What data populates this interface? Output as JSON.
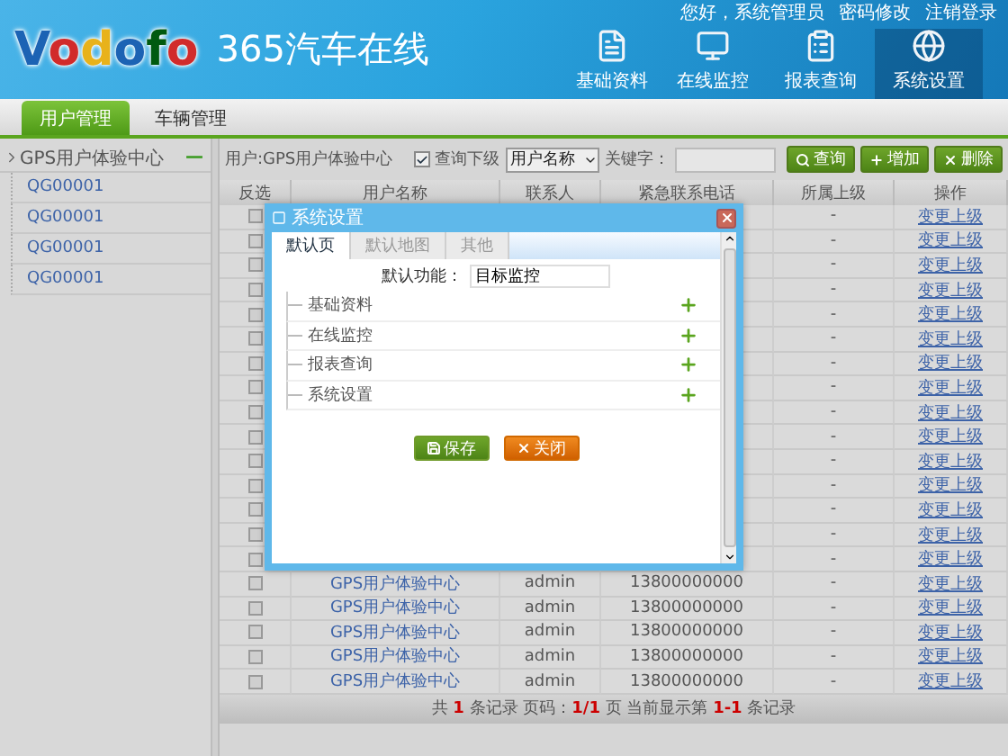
{
  "header": {
    "logo": "Vodofo",
    "product": "365汽车在线",
    "greeting": "您好，系统管理员",
    "links": [
      "密码修改",
      "注销登录"
    ],
    "nav": [
      {
        "label": "基础资料",
        "kind": "profile",
        "selected": false
      },
      {
        "label": "在线监控",
        "kind": "monitor",
        "selected": false
      },
      {
        "label": "报表查询",
        "kind": "report",
        "selected": false
      },
      {
        "label": "系统设置",
        "kind": "settings",
        "selected": true
      }
    ]
  },
  "tabs": [
    {
      "label": "用户管理",
      "selected": true
    },
    {
      "label": "车辆管理",
      "selected": false
    }
  ],
  "sidebar": {
    "root": {
      "label": "GPS用户体验中心",
      "expanded": true,
      "toggle": "—",
      "children": [
        {
          "label": "QG00001"
        },
        {
          "label": "QG00001"
        },
        {
          "label": "QG00001"
        },
        {
          "label": "QG00001"
        }
      ]
    }
  },
  "toolbar": {
    "user": "用户:GPS用户体验中心",
    "include_sub": {
      "label": "查询下级",
      "checked": true
    },
    "field_select": "用户名称",
    "keyword_label": "关键字：",
    "buttons": [
      {
        "label": "查询",
        "kind": "search"
      },
      {
        "label": "增加",
        "kind": "add"
      },
      {
        "label": "删除",
        "kind": "delete"
      }
    ]
  },
  "table": {
    "columns": [
      "反选",
      "用户名称",
      "联系人",
      "紧急联系电话",
      "所属上级",
      "操作"
    ],
    "rows": [
      {
        "checked": false,
        "superior": "-",
        "action": "变更上级"
      },
      {
        "checked": false,
        "superior": "-",
        "action": "变更上级"
      },
      {
        "checked": false,
        "superior": "-",
        "action": "变更上级"
      },
      {
        "checked": false,
        "superior": "-",
        "action": "变更上级"
      },
      {
        "checked": false,
        "superior": "-",
        "action": "变更上级"
      },
      {
        "checked": false,
        "superior": "-",
        "action": "变更上级"
      },
      {
        "checked": false,
        "superior": "-",
        "action": "变更上级"
      },
      {
        "checked": false,
        "superior": "-",
        "action": "变更上级"
      },
      {
        "checked": false,
        "superior": "-",
        "action": "变更上级"
      },
      {
        "checked": false,
        "superior": "-",
        "action": "变更上级"
      },
      {
        "checked": false,
        "superior": "-",
        "action": "变更上级"
      },
      {
        "checked": false,
        "superior": "-",
        "action": "变更上级"
      },
      {
        "checked": false,
        "superior": "-",
        "action": "变更上级"
      },
      {
        "checked": false,
        "superior": "-",
        "action": "变更上级"
      },
      {
        "checked": false,
        "superior": "-",
        "action": "变更上级"
      },
      {
        "checked": false,
        "name": "GPS用户体验中心",
        "contact": "admin",
        "phone": "13800000000",
        "superior": "-",
        "action": "变更上级"
      },
      {
        "checked": false,
        "name": "GPS用户体验中心",
        "contact": "admin",
        "phone": "13800000000",
        "superior": "-",
        "action": "变更上级"
      },
      {
        "checked": false,
        "name": "GPS用户体验中心",
        "contact": "admin",
        "phone": "13800000000",
        "superior": "-",
        "action": "变更上级"
      },
      {
        "checked": false,
        "name": "GPS用户体验中心",
        "contact": "admin",
        "phone": "13800000000",
        "superior": "-",
        "action": "变更上级"
      },
      {
        "checked": false,
        "name": "GPS用户体验中心",
        "contact": "admin",
        "phone": "13800000000",
        "superior": "-",
        "action": "变更上级"
      }
    ]
  },
  "pager": "共 **1** 条记录 页码：**1/1** 页 当前显示第 **1-1** 条记录",
  "dialog": {
    "title": "系统设置",
    "tabs": [
      {
        "label": "默认页",
        "selected": true
      },
      {
        "label": "默认地图",
        "selected": false
      },
      {
        "label": "其他",
        "selected": false
      }
    ],
    "default_label": "默认功能：",
    "default_value": "目标监控",
    "modules": [
      {
        "label": "基础资料",
        "expanded": false
      },
      {
        "label": "在线监控",
        "expanded": false
      },
      {
        "label": "报表查询",
        "expanded": false
      },
      {
        "label": "系统设置",
        "expanded": false
      }
    ],
    "buttons": [
      {
        "label": "保存",
        "kind": "save"
      },
      {
        "label": "关闭",
        "kind": "close"
      }
    ]
  }
}
